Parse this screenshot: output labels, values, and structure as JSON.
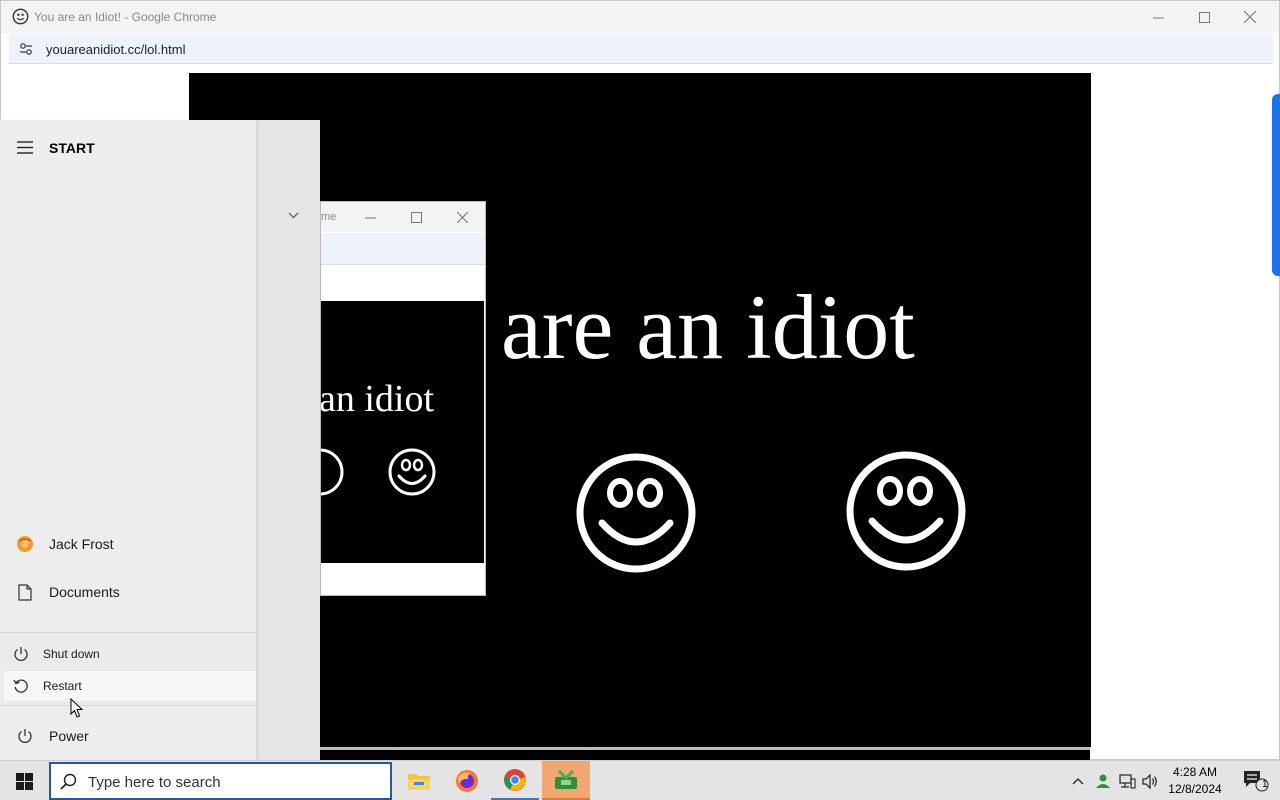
{
  "browser": {
    "window_title": "You are an Idiot! - Google Chrome",
    "url": "youareanidiot.cc/lol.html",
    "accent_color": "#1a73e8"
  },
  "page": {
    "headline": "are an idiot",
    "background_color": "#000000",
    "text_color": "#ffffff"
  },
  "popup": {
    "title_fragment": "me",
    "headline": "an idiot"
  },
  "start_menu": {
    "header_label": "START",
    "items": [
      {
        "label": "Jack Frost",
        "icon": "user-avatar-icon"
      },
      {
        "label": "Documents",
        "icon": "document-icon"
      },
      {
        "label": "Power",
        "icon": "power-icon"
      }
    ],
    "power_options": [
      {
        "label": "Shut down",
        "icon": "power-icon"
      },
      {
        "label": "Restart",
        "icon": "restart-icon"
      }
    ]
  },
  "taskbar": {
    "search_placeholder": "Type here to search",
    "apps": [
      "file-explorer-icon",
      "firefox-icon",
      "chrome-icon",
      "green-app-icon"
    ],
    "clock_time": "4:28 AM",
    "clock_date": "12/8/2024",
    "notification_count": "1"
  }
}
